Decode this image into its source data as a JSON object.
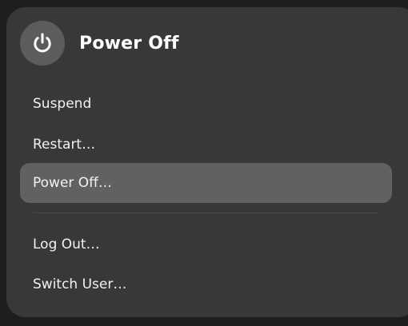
{
  "menu": {
    "title": "Power Off",
    "icon": "power-icon",
    "items": [
      {
        "label": "Suspend",
        "active": false
      },
      {
        "label": "Restart…",
        "active": false
      },
      {
        "label": "Power Off…",
        "active": true
      },
      {
        "label": "Log Out…",
        "active": false
      },
      {
        "label": "Switch User…",
        "active": false
      }
    ]
  },
  "colors": {
    "panel": "#383838",
    "highlight": "#616161",
    "icon_circle": "#5c5c5c",
    "text": "#ffffff"
  }
}
